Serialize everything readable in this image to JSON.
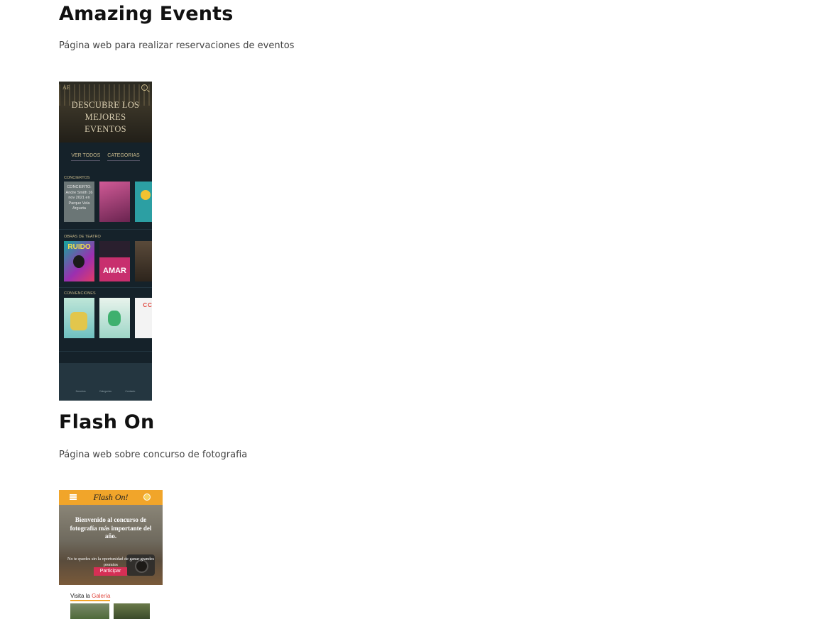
{
  "projects": [
    {
      "title": "Amazing Events",
      "description": "Página web para realizar reservaciones de eventos",
      "mockup": {
        "logo": "AE",
        "headline_lines": [
          "DESCUBRE LOS",
          "MEJORES",
          "EVENTOS"
        ],
        "nav": [
          "VER TODOS",
          "CATEGORIAS"
        ],
        "sections": [
          {
            "label": "CONCIERTOS",
            "posters": [
              {
                "text": "CONCIERTO: Andre Smith 16 nov 2021 en Parque Vela Arguzta",
                "color": "#6b7676"
              },
              {
                "text": "",
                "color": "#b2356c"
              },
              {
                "text": "",
                "color": "#2c9fa3"
              }
            ]
          },
          {
            "label": "OBRAS DE TEATRO",
            "posters": [
              {
                "text": "RUIDO",
                "color": "#1aa59b"
              },
              {
                "text": "AMAR",
                "color": "#c82f6e"
              },
              {
                "text": "",
                "color": "#5a4a3a"
              }
            ]
          },
          {
            "label": "CONVENCIONES",
            "posters": [
              {
                "text": "",
                "color": "#7fc9c8"
              },
              {
                "text": "",
                "color": "#9ed6c7"
              },
              {
                "text": "CCC",
                "color": "#f3f3f3"
              }
            ]
          }
        ],
        "footer_links": [
          "Nosotros",
          "Categorías",
          "Contacto"
        ]
      },
      "colors": {
        "background": "#15222a",
        "accent": "#c9b98a"
      }
    },
    {
      "title": "Flash On",
      "description": "Página web sobre concurso de fotografia",
      "mockup": {
        "brand": "Flash On!",
        "headline": "Bienvenido al concurso de fotografía más importante del año.",
        "subtext": "No te quedes sin la oportunidad de ganar grandes premios",
        "cta": "Participar",
        "visit_prefix": "Visita la ",
        "visit_link": "Galería"
      },
      "colors": {
        "bar": "#f1a52a",
        "cta": "#d62f55",
        "link": "#e0473e"
      }
    }
  ]
}
